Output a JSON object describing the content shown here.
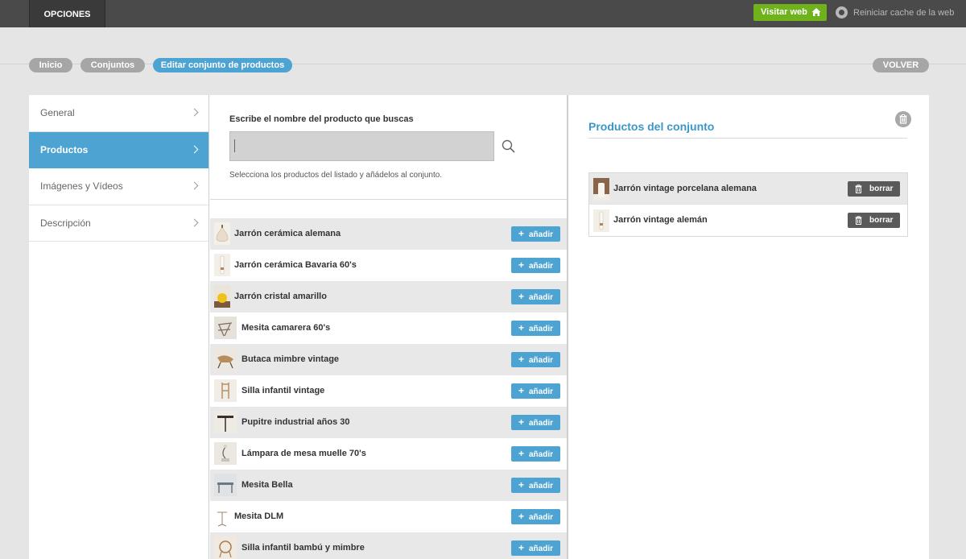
{
  "topbar": {
    "options_label": "OPCIONES",
    "visit_label": "Visitar web",
    "reset_cache_label": "Reiniciar cache de la web"
  },
  "breadcrumb": {
    "items": [
      "Inicio",
      "Conjuntos",
      "Editar conjunto de productos"
    ],
    "back_label": "VOLVER"
  },
  "sidebar": {
    "items": [
      {
        "label": "General",
        "active": false
      },
      {
        "label": "Productos",
        "active": true
      },
      {
        "label": "Imágenes y Vídeos",
        "active": false
      },
      {
        "label": "Descripción",
        "active": false
      }
    ]
  },
  "search": {
    "label": "Escribe el nombre del producto que buscas",
    "value": "",
    "placeholder": "",
    "help": "Selecciona los productos del listado y añádelos al conjunto."
  },
  "product_list": {
    "add_label": "añadir",
    "items": [
      "Jarrón cerámica alemana",
      "Jarrón cerámica Bavaria 60's",
      "Jarrón cristal amarillo",
      "Mesita camarera 60's",
      "Butaca mimbre vintage",
      "Silla infantil vintage",
      "Pupitre industrial años 30",
      "Lámpara de mesa muelle 70's",
      "Mesita Bella",
      "Mesita DLM",
      "Silla infantil bambú y mimbre"
    ]
  },
  "set": {
    "title": "Productos del conjunto",
    "delete_label": "borrar",
    "items": [
      "Jarrón vintage porcelana alemana",
      "Jarrón vintage alemán"
    ]
  },
  "colors": {
    "accent": "#4da3d1",
    "topbar": "#4a4a4a",
    "visit_green": "#6fb21c",
    "delete_button": "#5a5a5a"
  }
}
